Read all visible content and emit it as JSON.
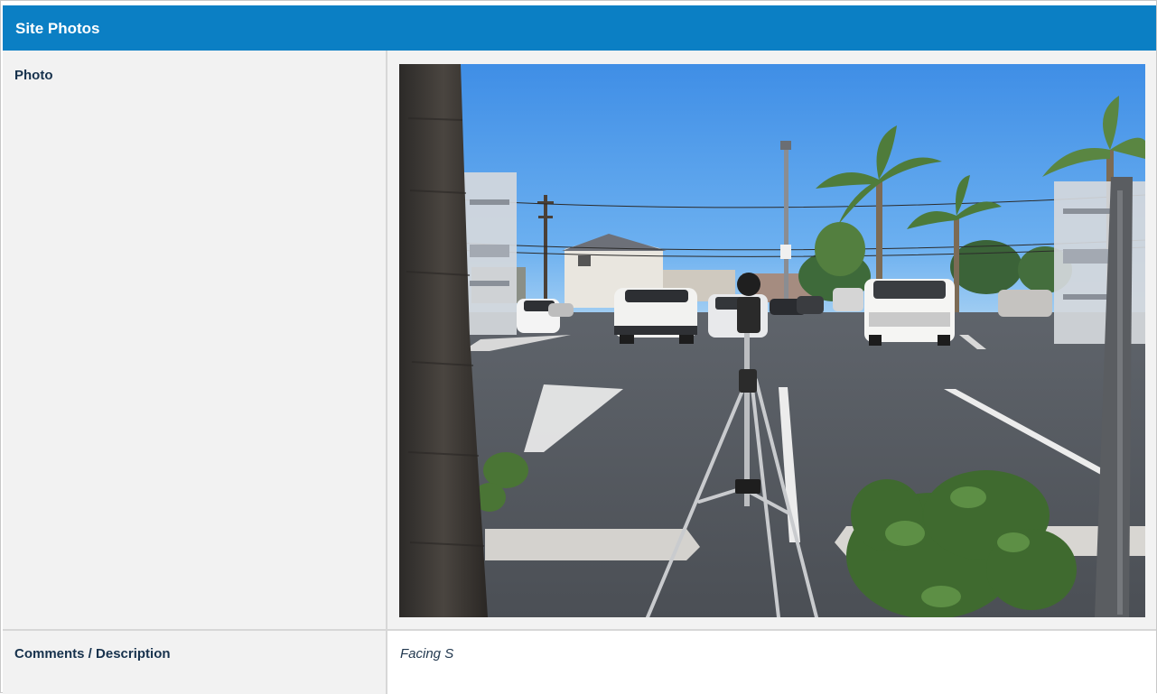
{
  "section": {
    "title": "Site Photos",
    "header_color": "#0b7fc4"
  },
  "photo_row": {
    "label": "Photo"
  },
  "comments_row": {
    "label": "Comments / Description",
    "value": "Facing S"
  }
}
